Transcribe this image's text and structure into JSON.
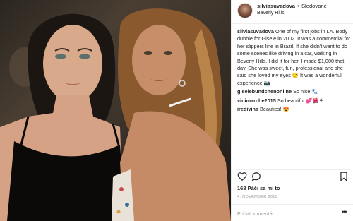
{
  "post": {
    "username": "silviasuvadova",
    "separator": "•",
    "follow_status": "Sledované",
    "location": "Beverly Hills",
    "caption_user": "silviasuvadova",
    "caption_text": "One of my first jobs in LA. Body dubble for Gisele in 2002. It was a commercial for her slippers line in Brazil. If she didn't want to do some scenes like driving in a car, walking in Beverly Hills. I did it for her. I made $1,000 that day. She was sweet, fun, professional and she said she loved my eyes 🙂 It was a wonderful experience 📷",
    "comments": [
      {
        "user": "giselebundchenonline",
        "text": "So nice 🐾"
      },
      {
        "user": "vinimarche2015",
        "text": "So beautiful 💕🌺⚘"
      },
      {
        "user": "iredivina",
        "text": "Beauties! 😍"
      }
    ],
    "likes": "168 Páči sa mi to",
    "date": "4. NOVEMBER 2015",
    "add_comment_placeholder": "Pridať komentár...",
    "more_options": "•••"
  },
  "icons": {
    "like": "heart-icon",
    "comment": "comment-bubble-icon",
    "save": "bookmark-icon",
    "more": "more-options-icon"
  },
  "colors": {
    "text": "#262626",
    "muted": "#999999",
    "divider": "#efefef"
  }
}
